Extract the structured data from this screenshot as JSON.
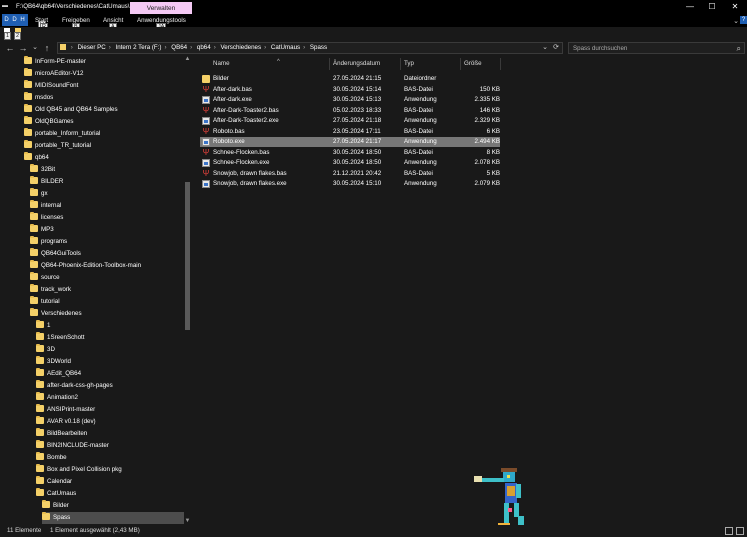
{
  "window": {
    "title": "F:\\QB64\\qb64\\Verschiedenes\\CatUmaus\\S...",
    "context_tab": "Verwalten",
    "controls": {
      "minimize": "—",
      "maximize": "☐",
      "close": "✕"
    }
  },
  "ribbon": {
    "file_tab": "D D H",
    "tabs": [
      "Start",
      "Freigeben",
      "Ansicht",
      "Anwendungstools"
    ],
    "keytips": {
      "file": "H",
      "start": "R",
      "freigeben": "B",
      "ansicht": "A",
      "tools": "JA",
      "qa1": "1",
      "qa2": "2"
    },
    "expand": "⌄",
    "help": "?"
  },
  "address": {
    "crumbs": [
      "Dieser PC",
      "Intern 2 Tera (F:)",
      "QB64",
      "qb64",
      "Verschiedenes",
      "CatUmaus",
      "Spass"
    ],
    "search_placeholder": "Spass durchsuchen"
  },
  "nav": {
    "back": "←",
    "forward": "→",
    "recent": "⌄",
    "up": "↑",
    "refresh": "⟳"
  },
  "tree": [
    {
      "label": "InForm-PE-master",
      "level": 1
    },
    {
      "label": "microAEditor-V12",
      "level": 1
    },
    {
      "label": "MIDISoundFont",
      "level": 1
    },
    {
      "label": "msdos",
      "level": 1
    },
    {
      "label": "Old QB45 and QB64 Samples",
      "level": 1
    },
    {
      "label": "OldQBGames",
      "level": 1
    },
    {
      "label": "portable_Inform_tutorial",
      "level": 1
    },
    {
      "label": "portable_TR_tutorial",
      "level": 1
    },
    {
      "label": "qb64",
      "level": 1
    },
    {
      "label": "32Bit",
      "level": 2
    },
    {
      "label": "BILDER",
      "level": 2
    },
    {
      "label": "gx",
      "level": 2
    },
    {
      "label": "internal",
      "level": 2
    },
    {
      "label": "licenses",
      "level": 2
    },
    {
      "label": "MP3",
      "level": 2
    },
    {
      "label": "programs",
      "level": 2
    },
    {
      "label": "QB64GuiTools",
      "level": 2
    },
    {
      "label": "QB64-Phoenix-Edition-Toolbox-main",
      "level": 2
    },
    {
      "label": "source",
      "level": 2
    },
    {
      "label": "track_work",
      "level": 2
    },
    {
      "label": "tutorial",
      "level": 2
    },
    {
      "label": "Verschiedenes",
      "level": 2
    },
    {
      "label": "1",
      "level": 3
    },
    {
      "label": "1SreenSchott",
      "level": 3
    },
    {
      "label": "3D",
      "level": 3
    },
    {
      "label": "3DWorld",
      "level": 3
    },
    {
      "label": "AEdit_QB64",
      "level": 3
    },
    {
      "label": "after-dark-css-gh-pages",
      "level": 3
    },
    {
      "label": "Animation2",
      "level": 3
    },
    {
      "label": "ANSIPrint-master",
      "level": 3
    },
    {
      "label": "AVAR v0.18 (dev)",
      "level": 3
    },
    {
      "label": "BildBearbeiten",
      "level": 3
    },
    {
      "label": "BIN2INCLUDE-master",
      "level": 3
    },
    {
      "label": "Bombe",
      "level": 3
    },
    {
      "label": "Box and Pixel Collision pkg",
      "level": 3
    },
    {
      "label": "Calendar",
      "level": 3
    },
    {
      "label": "CatUmaus",
      "level": 3
    },
    {
      "label": "Bilder",
      "level": 4
    },
    {
      "label": "Spass",
      "level": 4,
      "selected": true
    }
  ],
  "columns": {
    "name": "Name",
    "date": "Änderungsdatum",
    "type": "Typ",
    "size": "Größe",
    "sort_caret": "^"
  },
  "files": [
    {
      "name": "Bilder",
      "date": "27.05.2024 21:15",
      "type": "Dateiordner",
      "size": "",
      "icon": "folder-icon"
    },
    {
      "name": "After-dark.bas",
      "date": "30.05.2024 15:14",
      "type": "BAS-Datei",
      "size": "150 KB",
      "icon": "bas-file-icon"
    },
    {
      "name": "After-dark.exe",
      "date": "30.05.2024 15:13",
      "type": "Anwendung",
      "size": "2.335 KB",
      "icon": "exe-file-icon"
    },
    {
      "name": "After-Dark-Toaster2.bas",
      "date": "05.02.2023 18:33",
      "type": "BAS-Datei",
      "size": "146 KB",
      "icon": "bas-file-icon"
    },
    {
      "name": "After-Dark-Toaster2.exe",
      "date": "27.05.2024 21:18",
      "type": "Anwendung",
      "size": "2.329 KB",
      "icon": "exe-file-icon"
    },
    {
      "name": "Roboto.bas",
      "date": "23.05.2024 17:11",
      "type": "BAS-Datei",
      "size": "6 KB",
      "icon": "bas-file-icon"
    },
    {
      "name": "Roboto.exe",
      "date": "27.05.2024 21:17",
      "type": "Anwendung",
      "size": "2.494 KB",
      "icon": "exe-file-icon",
      "selected": true
    },
    {
      "name": "Schnee-Flocken.bas",
      "date": "30.05.2024 18:50",
      "type": "BAS-Datei",
      "size": "8 KB",
      "icon": "bas-file-icon"
    },
    {
      "name": "Schnee-Flocken.exe",
      "date": "30.05.2024 18:50",
      "type": "Anwendung",
      "size": "2.078 KB",
      "icon": "exe-file-icon"
    },
    {
      "name": "Snowjob, drawn flakes.bas",
      "date": "21.12.2021 20:42",
      "type": "BAS-Datei",
      "size": "5 KB",
      "icon": "bas-file-icon"
    },
    {
      "name": "Snowjob, drawn flakes.exe",
      "date": "30.05.2024 15:10",
      "type": "Anwendung",
      "size": "2.079 KB",
      "icon": "exe-file-icon"
    }
  ],
  "status": {
    "count": "11 Elemente",
    "selection": "1 Element ausgewählt (2,43 MB)"
  },
  "colors": {
    "accent": "#1f5fb3",
    "context_tab": "#f4c9f4",
    "folder": "#f4d068"
  }
}
